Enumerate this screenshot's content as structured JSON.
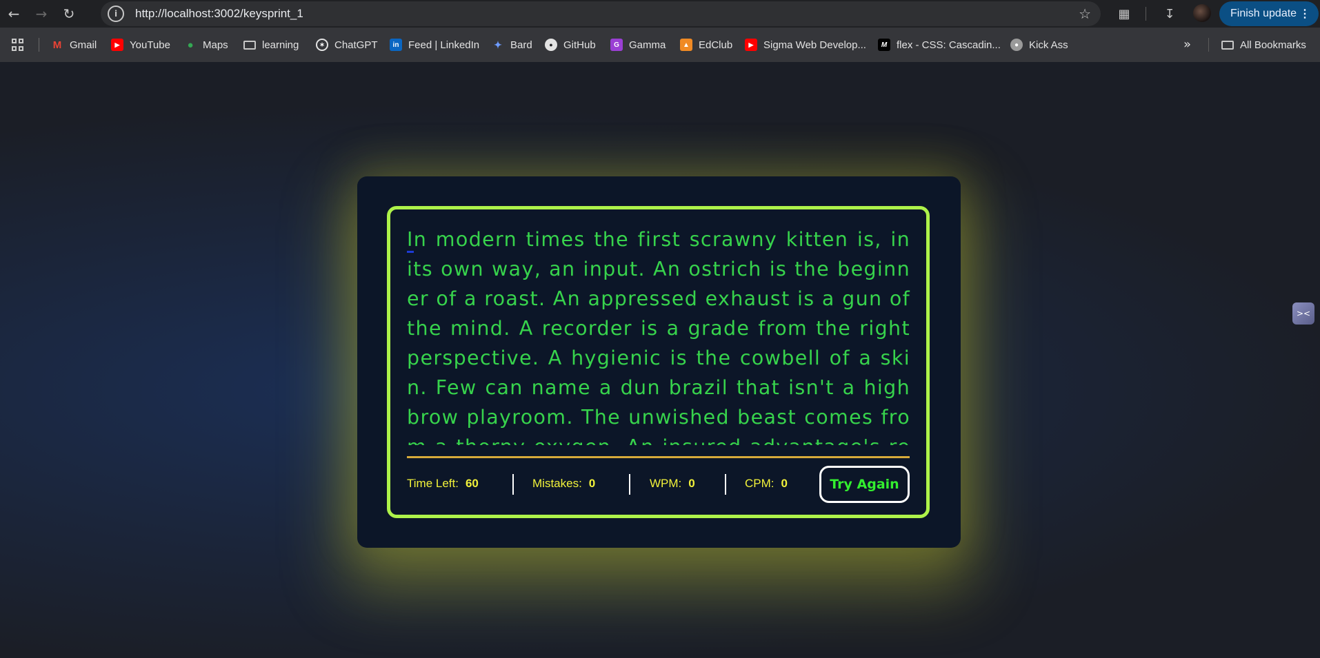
{
  "browser": {
    "url": "http://localhost:3002/keysprint_1",
    "finish_update_label": "Finish update",
    "bookmarks": [
      {
        "label": "Gmail",
        "icon": "gmail-icon"
      },
      {
        "label": "YouTube",
        "icon": "youtube-icon"
      },
      {
        "label": "Maps",
        "icon": "maps-icon"
      },
      {
        "label": "learning",
        "icon": "folder-icon"
      },
      {
        "label": "ChatGPT",
        "icon": "chatgpt-icon"
      },
      {
        "label": "Feed | LinkedIn",
        "icon": "linkedin-icon"
      },
      {
        "label": "Bard",
        "icon": "bard-icon"
      },
      {
        "label": "GitHub",
        "icon": "github-icon"
      },
      {
        "label": "Gamma",
        "icon": "gamma-icon"
      },
      {
        "label": "EdClub",
        "icon": "edclub-icon"
      },
      {
        "label": "Sigma Web Develop...",
        "icon": "youtube-icon"
      },
      {
        "label": "flex - CSS: Cascadin...",
        "icon": "mdn-icon"
      },
      {
        "label": "Kick Ass",
        "icon": "globe-icon"
      }
    ],
    "all_bookmarks_label": "All Bookmarks"
  },
  "typing": {
    "first_char": "I",
    "passage": "n modern times the first scrawny kitten is, in its own way, an input. An ostrich is the beginner of a roast. An appressed exhaust is a gun of the mind. A recorder is a grade from the right perspective. A hygienic is the cowbell of a skin. Few can name a dun brazil that isn't a highbrow playroom. The unwished beast comes from a thorny oxygen. An insured advantage's reaso"
  },
  "stats": {
    "time_left_label": "Time Left:",
    "time_left_value": "60",
    "mistakes_label": "Mistakes:",
    "mistakes_value": "0",
    "wpm_label": "WPM:",
    "wpm_value": "0",
    "cpm_label": "CPM:",
    "cpm_value": "0"
  },
  "try_again_label": "Try Again",
  "colors": {
    "text": "#37d34c",
    "border": "#aef24a",
    "divider": "#d7aa3a",
    "stat_text": "#f2f23a",
    "button_text": "#33ee2f",
    "card_bg": "#0c1628"
  }
}
